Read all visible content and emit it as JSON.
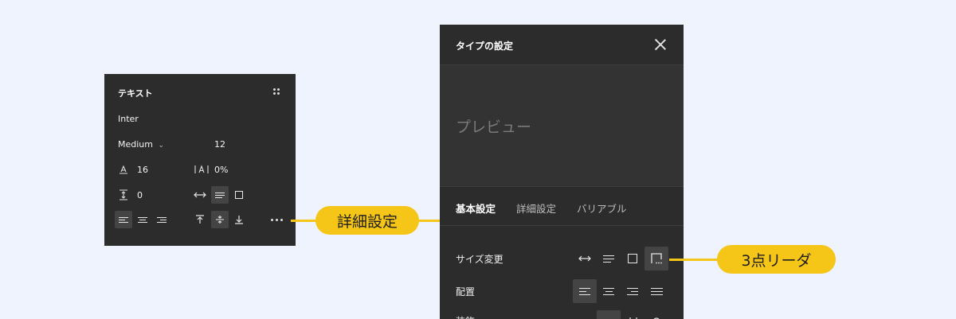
{
  "text_panel": {
    "title": "テキスト",
    "font_family": "Inter",
    "font_weight": "Medium",
    "font_size": "12",
    "line_height": "16",
    "letter_spacing": "0%",
    "paragraph_spacing": "0",
    "icons": {
      "grip": "grip-dots-icon",
      "line_height": "line-height-icon",
      "letter_spacing": "letter-spacing-icon",
      "paragraph_spacing": "paragraph-spacing-icon",
      "more": "more-options-icon"
    }
  },
  "callouts": {
    "details": "詳細設定",
    "ellipsis": "3点リーダ",
    "color": "#f5c518"
  },
  "dialog": {
    "title": "タイプの設定",
    "preview": "プレビュー",
    "tabs": [
      "基本設定",
      "詳細設定",
      "バリアブル"
    ],
    "resize_label": "サイズ変更",
    "align_label": "配置",
    "next_label": "装飾"
  },
  "colors": {
    "background": "#eef3fd",
    "panel": "#2c2c2c",
    "accent": "#f5c518"
  }
}
